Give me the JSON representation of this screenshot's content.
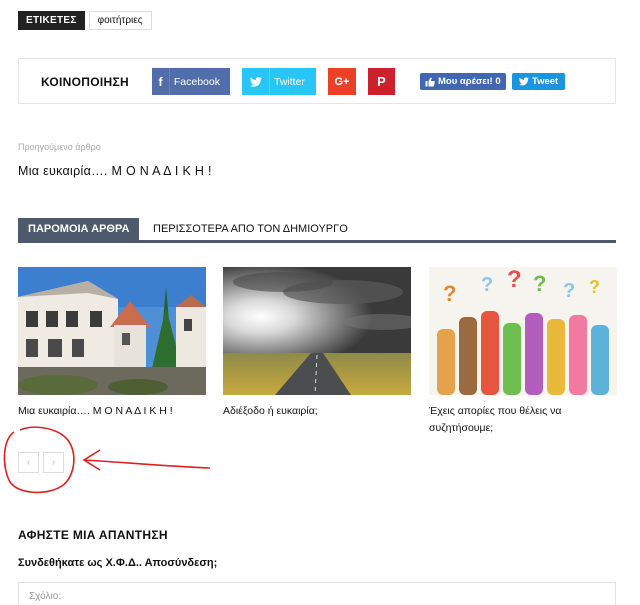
{
  "tags": {
    "label": "ΕΤΙΚΕΤΕΣ",
    "items": [
      "φοιτήτριες"
    ]
  },
  "share": {
    "title": "ΚΟΙΝΟΠΟΙΗΣΗ",
    "facebook": "Facebook",
    "twitter": "Twitter",
    "googleplus": "G+",
    "pinterest": "P",
    "like": "Μου αρέσει! 0",
    "tweet": "Tweet",
    "colors": {
      "facebook": "#516eab",
      "twitter": "#29c5f6",
      "googleplus": "#eb4026",
      "pinterest": "#ca212a"
    }
  },
  "previous": {
    "label": "Προηγούμενο άρθρο",
    "title": "Μια ευκαιρία…. Μ Ο Ν Α Δ Ι Κ Η !"
  },
  "related": {
    "tab_active": "ΠΑΡΟΜΟΙΑ ΑΡΘΡΑ",
    "tab_other": "ΠΕΡΙΣΣΟΤΕΡΑ ΑΠΟ ΤΟΝ ΔΗΜΙΟΥΡΓΟ",
    "accent": "#4c5a6b",
    "cards": [
      {
        "title": "Μια ευκαιρία…. Μ Ο Ν Α Δ Ι Κ Η !"
      },
      {
        "title": "Αδιέξοδο ή ευκαιρία;"
      },
      {
        "title": "Έχεις απορίες που θέλεις να συζητήσουμε;"
      }
    ],
    "pager": {
      "prev": "‹",
      "next": "›"
    }
  },
  "reply": {
    "title": "ΑΦΗΣΤΕ ΜΙΑ ΑΠΑΝΤΗΣΗ",
    "logged_in": "Συνδεθήκατε ως Χ.Φ.Δ.. Αποσύνδεση;",
    "comment_placeholder": "Σχόλιο:"
  },
  "annotation_color": "#e02020"
}
